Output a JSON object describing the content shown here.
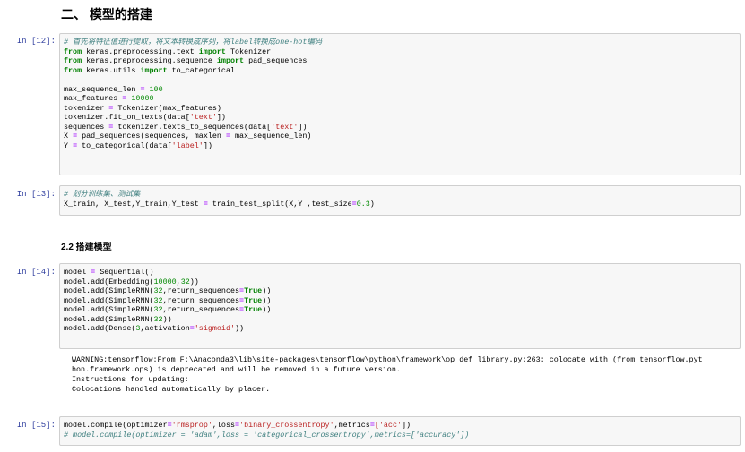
{
  "headings": {
    "section": "二、 模型的搭建",
    "subsection": "2.2 搭建模型"
  },
  "cells": [
    {
      "prompt": "In [12]:",
      "lines": [
        [
          {
            "t": "# 首先将特征值进行提取，将文本转换成序列，将label转换成one-hot编码",
            "c": "c"
          }
        ],
        [
          {
            "t": "from",
            "c": "k"
          },
          {
            "t": " keras.preprocessing.text "
          },
          {
            "t": "import",
            "c": "k"
          },
          {
            "t": " Tokenizer"
          }
        ],
        [
          {
            "t": "from",
            "c": "k"
          },
          {
            "t": " keras.preprocessing.sequence "
          },
          {
            "t": "import",
            "c": "k"
          },
          {
            "t": " pad_sequences"
          }
        ],
        [
          {
            "t": "from",
            "c": "k"
          },
          {
            "t": " keras.utils "
          },
          {
            "t": "import",
            "c": "k"
          },
          {
            "t": " to_categorical"
          }
        ],
        [],
        [
          {
            "t": "max_sequence_len "
          },
          {
            "t": "=",
            "c": "o"
          },
          {
            "t": " "
          },
          {
            "t": "100",
            "c": "n"
          }
        ],
        [
          {
            "t": "max_features "
          },
          {
            "t": "=",
            "c": "o"
          },
          {
            "t": " "
          },
          {
            "t": "10000",
            "c": "n"
          }
        ],
        [
          {
            "t": "tokenizer "
          },
          {
            "t": "=",
            "c": "o"
          },
          {
            "t": " Tokenizer(max_features)"
          }
        ],
        [
          {
            "t": "tokenizer.fit_on_texts(data["
          },
          {
            "t": "'text'",
            "c": "s"
          },
          {
            "t": "])"
          }
        ],
        [
          {
            "t": "sequences "
          },
          {
            "t": "=",
            "c": "o"
          },
          {
            "t": " tokenizer.texts_to_sequences(data["
          },
          {
            "t": "'text'",
            "c": "s"
          },
          {
            "t": "])"
          }
        ],
        [
          {
            "t": "X "
          },
          {
            "t": "=",
            "c": "o"
          },
          {
            "t": " pad_sequences(sequences, maxlen "
          },
          {
            "t": "=",
            "c": "o"
          },
          {
            "t": " max_sequence_len)"
          }
        ],
        [
          {
            "t": "Y "
          },
          {
            "t": "=",
            "c": "o"
          },
          {
            "t": " to_categorical(data["
          },
          {
            "t": "'label'",
            "c": "s"
          },
          {
            "t": "])"
          }
        ]
      ]
    },
    {
      "prompt": "In [13]:",
      "lines": [
        [
          {
            "t": "# 划分训练集、测试集",
            "c": "c"
          }
        ],
        [
          {
            "t": "X_train, X_test,Y_train,Y_test "
          },
          {
            "t": "=",
            "c": "o"
          },
          {
            "t": " train_test_split(X,Y ,test_size"
          },
          {
            "t": "=",
            "c": "o"
          },
          {
            "t": "0.3",
            "c": "n"
          },
          {
            "t": ")"
          }
        ]
      ]
    },
    {
      "prompt": "In [14]:",
      "lines": [
        [
          {
            "t": "model "
          },
          {
            "t": "=",
            "c": "o"
          },
          {
            "t": " Sequential()"
          }
        ],
        [
          {
            "t": "model.add(Embedding("
          },
          {
            "t": "10000",
            "c": "n"
          },
          {
            "t": ","
          },
          {
            "t": "32",
            "c": "n"
          },
          {
            "t": "))"
          }
        ],
        [
          {
            "t": "model.add(SimpleRNN("
          },
          {
            "t": "32",
            "c": "n"
          },
          {
            "t": ",return_sequences"
          },
          {
            "t": "=",
            "c": "o"
          },
          {
            "t": "True",
            "c": "k"
          },
          {
            "t": "))"
          }
        ],
        [
          {
            "t": "model.add(SimpleRNN("
          },
          {
            "t": "32",
            "c": "n"
          },
          {
            "t": ",return_sequences"
          },
          {
            "t": "=",
            "c": "o"
          },
          {
            "t": "True",
            "c": "k"
          },
          {
            "t": "))"
          }
        ],
        [
          {
            "t": "model.add(SimpleRNN("
          },
          {
            "t": "32",
            "c": "n"
          },
          {
            "t": ",return_sequences"
          },
          {
            "t": "=",
            "c": "o"
          },
          {
            "t": "True",
            "c": "k"
          },
          {
            "t": "))"
          }
        ],
        [
          {
            "t": "model.add(SimpleRNN("
          },
          {
            "t": "32",
            "c": "n"
          },
          {
            "t": "))"
          }
        ],
        [
          {
            "t": "model.add(Dense("
          },
          {
            "t": "3",
            "c": "n"
          },
          {
            "t": ",activation"
          },
          {
            "t": "=",
            "c": "o"
          },
          {
            "t": "'sigmoid'",
            "c": "s"
          },
          {
            "t": "))"
          }
        ]
      ],
      "output": "WARNING:tensorflow:From F:\\Anaconda3\\lib\\site-packages\\tensorflow\\python\\framework\\op_def_library.py:263: colocate_with (from tensorflow.pyt\nhon.framework.ops) is deprecated and will be removed in a future version.\nInstructions for updating:\nColocations handled automatically by placer."
    },
    {
      "prompt": "In [15]:",
      "lines": [
        [
          {
            "t": "model.compile(optimizer"
          },
          {
            "t": "=",
            "c": "o"
          },
          {
            "t": "'rmsprop'",
            "c": "s"
          },
          {
            "t": ",loss"
          },
          {
            "t": "=",
            "c": "o"
          },
          {
            "t": "'binary_crossentropy'",
            "c": "s"
          },
          {
            "t": ",metrics"
          },
          {
            "t": "=",
            "c": "o"
          },
          {
            "t": "['acc'",
            "c": "s"
          },
          {
            "t": "])"
          }
        ],
        [
          {
            "t": "# model.compile(optimizer = 'adam',loss = 'categorical_crossentropy',metrics=['accuracy'])",
            "c": "c"
          }
        ]
      ]
    }
  ]
}
